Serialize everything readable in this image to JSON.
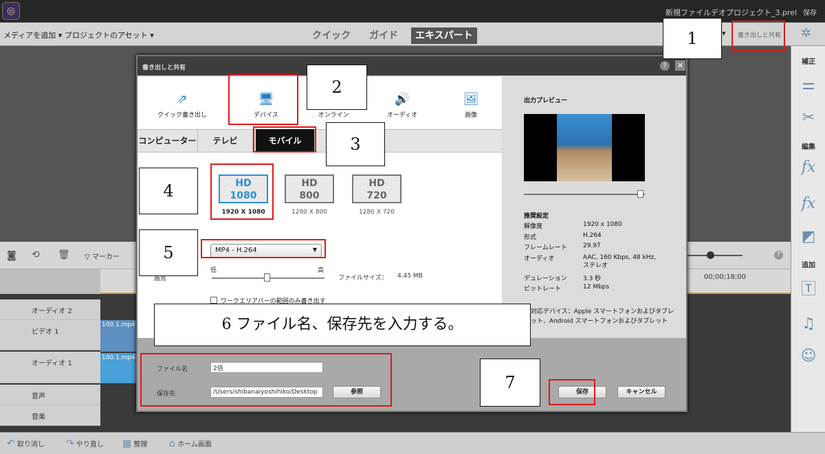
{
  "app": {
    "project_title": "新規ファイルデオプロジェクト_3.prel",
    "save_label": "保存"
  },
  "menubar": {
    "add_media": "メディアを追加 ▾",
    "project_assets": "プロジェクトのアセット ▾",
    "tabs": [
      "クイック",
      "ガイド",
      "エキスパート"
    ],
    "export_share": "書き出しと共有"
  },
  "right_panel": {
    "correct": "補正",
    "edit": "編集",
    "add": "追加"
  },
  "timeline": {
    "marker": "マーカー",
    "timecode": "00;00;18;00",
    "tracks": [
      "オーディオ 2",
      "ビデオ 1",
      "オーディオ 1",
      "音声",
      "音楽"
    ],
    "clip": "100.1.mp4"
  },
  "bottombar": {
    "undo": "取り消し",
    "redo": "やり直し",
    "organize": "整理",
    "home": "ホーム画面"
  },
  "dialog": {
    "title": "書き出しと共有",
    "categories": [
      "クイック書き出し",
      "デバイス",
      "オンライン",
      "オーディオ",
      "画像"
    ],
    "subtabs": [
      "コンピューター",
      "テレビ",
      "モバイル"
    ],
    "presets": [
      {
        "top": "HD",
        "bottom": "1080",
        "label": "1920 X 1080"
      },
      {
        "top": "HD",
        "bottom": "800",
        "label": "1280 X 800"
      },
      {
        "top": "HD",
        "bottom": "720",
        "label": "1280 X 720"
      }
    ],
    "format": "MP4 - H.264",
    "quality_low": "低",
    "quality_high": "高",
    "quality_label": "画質",
    "filesize_label": "ファイルサイズ：",
    "filesize_value": "4.45 MB",
    "workarea_checkbox": "ワークエリアバーの範囲のみ書き出す",
    "filename_label": "ファイル名",
    "filename_value": "2倍",
    "location_label": "保存先",
    "location_value": "/Users/shibanaiyoshihiko/Desktop",
    "browse_button": "参照",
    "save_button": "保存",
    "cancel_button": "キャンセル",
    "preview_title": "出力プレビュー",
    "recommended": "推奨設定",
    "settings": [
      {
        "k": "解像度",
        "v": "1920 x 1080"
      },
      {
        "k": "形式",
        "v": "H.264"
      },
      {
        "k": "フレームレート",
        "v": "29.97"
      },
      {
        "k": "オーディオ",
        "v": "AAC, 160 Kbps, 48 kHz, ステレオ"
      },
      {
        "k": "デュレーション",
        "v": "3.3 秒"
      },
      {
        "k": "ビットレート",
        "v": "12 Mbps"
      }
    ],
    "devices_prefix": "対応デバイス：Apple スマートフォンおよびタブレ",
    "devices_suffix": "ット、Android スマートフォンおよびタブレット"
  },
  "callouts": {
    "n1": "1",
    "n2": "2",
    "n3": "3",
    "n4": "4",
    "n5": "5",
    "n6": "6 ファイル名、保存先を入力する。",
    "n7": "7"
  }
}
